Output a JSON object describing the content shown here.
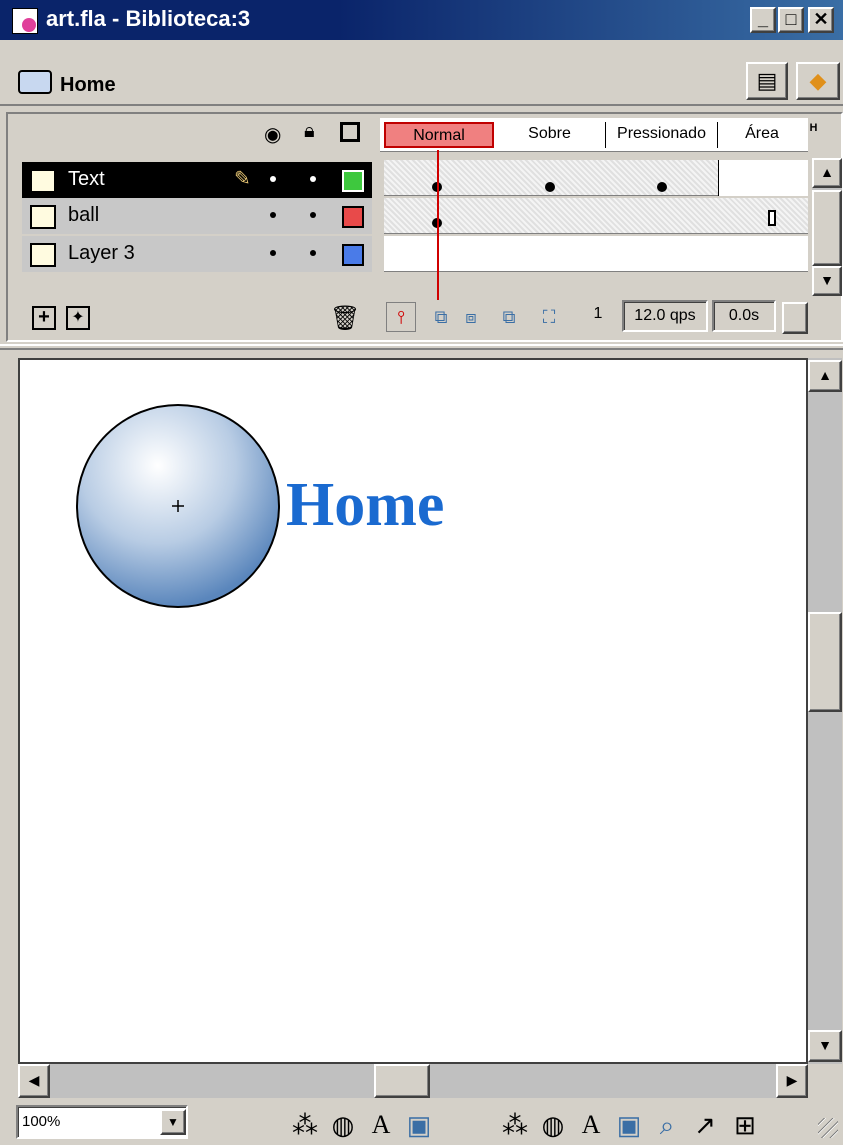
{
  "window": {
    "title": "art.fla - Biblioteca:3",
    "minimize": "_",
    "maximize": "□",
    "close": "✕"
  },
  "breadcrumb": {
    "scene": "Home"
  },
  "timeline": {
    "header_icons": [
      "eye-icon",
      "lock-icon",
      "outline-icon"
    ],
    "frames": [
      "Normal",
      "Sobre",
      "Pressionado",
      "Área"
    ],
    "layers": [
      {
        "name": "Text",
        "color": "#3ec83e",
        "active": true
      },
      {
        "name": "ball",
        "color": "#e84a4a",
        "active": false
      },
      {
        "name": "Layer 3",
        "color": "#4a7be8",
        "active": false
      }
    ],
    "status": {
      "frame": "1",
      "fps": "12.0 qps",
      "time": "0.0s"
    }
  },
  "stage": {
    "text": "Home",
    "text_color": "#1a6ad0"
  },
  "bottom": {
    "zoom": "100%"
  }
}
